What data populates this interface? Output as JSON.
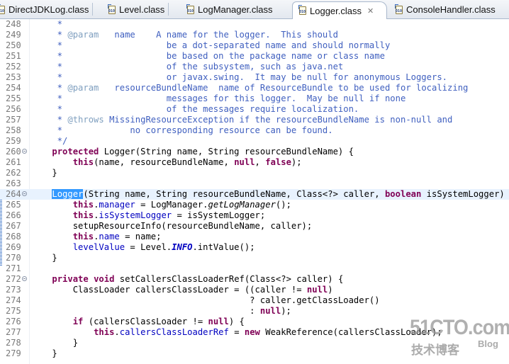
{
  "tabs": [
    {
      "label": "DirectJDKLog.class",
      "active": false
    },
    {
      "label": "Level.class",
      "active": false
    },
    {
      "label": "LogManager.class",
      "active": false
    },
    {
      "label": "Logger.class",
      "active": true,
      "close_icon": "close-icon"
    },
    {
      "label": "ConsoleHandler.class",
      "active": false
    }
  ],
  "editor": {
    "lines": [
      {
        "n": "248",
        "tokens": [
          [
            "cm",
            "     *"
          ]
        ]
      },
      {
        "n": "249",
        "tokens": [
          [
            "cm",
            "     * "
          ],
          [
            "tag",
            "@param"
          ],
          [
            "cm",
            "   name    A name for the logger.  This should"
          ]
        ]
      },
      {
        "n": "250",
        "tokens": [
          [
            "cm",
            "     *                    be a dot-separated name and should normally"
          ]
        ]
      },
      {
        "n": "251",
        "tokens": [
          [
            "cm",
            "     *                    be based on the package name or class name"
          ]
        ]
      },
      {
        "n": "252",
        "tokens": [
          [
            "cm",
            "     *                    of the subsystem, such as java.net"
          ]
        ]
      },
      {
        "n": "253",
        "tokens": [
          [
            "cm",
            "     *                    or javax.swing.  It may be null for anonymous Loggers."
          ]
        ]
      },
      {
        "n": "254",
        "tokens": [
          [
            "cm",
            "     * "
          ],
          [
            "tag",
            "@param"
          ],
          [
            "cm",
            "   resourceBundleName  name of ResourceBundle to be used for localizing"
          ]
        ]
      },
      {
        "n": "255",
        "tokens": [
          [
            "cm",
            "     *                    messages for this logger.  May be null if none"
          ]
        ]
      },
      {
        "n": "256",
        "tokens": [
          [
            "cm",
            "     *                    of the messages require localization."
          ]
        ]
      },
      {
        "n": "257",
        "tokens": [
          [
            "cm",
            "     * "
          ],
          [
            "tag",
            "@throws"
          ],
          [
            "cm",
            " MissingResourceException if the resourceBundleName is non-null and"
          ]
        ]
      },
      {
        "n": "258",
        "tokens": [
          [
            "cm",
            "     *             no corresponding resource can be found."
          ]
        ]
      },
      {
        "n": "259",
        "tokens": [
          [
            "cm",
            "     */"
          ]
        ]
      },
      {
        "n": "260",
        "fold": true,
        "tokens": [
          [
            "",
            "    "
          ],
          [
            "kw",
            "protected"
          ],
          [
            "",
            " Logger(String name, String resourceBundleName) {"
          ]
        ]
      },
      {
        "n": "261",
        "tokens": [
          [
            "",
            "        "
          ],
          [
            "kw",
            "this"
          ],
          [
            "",
            "(name, resourceBundleName, "
          ],
          [
            "kw",
            "null"
          ],
          [
            "",
            ", "
          ],
          [
            "kw",
            "false"
          ],
          [
            "",
            ");"
          ]
        ]
      },
      {
        "n": "262",
        "tokens": [
          [
            "",
            "    }"
          ]
        ]
      },
      {
        "n": "263",
        "tokens": []
      },
      {
        "n": "264",
        "fold": true,
        "current": true,
        "tokens": [
          [
            "",
            "    "
          ],
          [
            "sel",
            "Logger"
          ],
          [
            "",
            "(String name, String resourceBundleName, Class<?> caller, "
          ],
          [
            "kw",
            "boolean"
          ],
          [
            "",
            " isSystemLogger) {"
          ]
        ]
      },
      {
        "n": "265",
        "tokens": [
          [
            "",
            "        "
          ],
          [
            "kw",
            "this"
          ],
          [
            "",
            "."
          ],
          [
            "fld",
            "manager"
          ],
          [
            "",
            " = LogManager."
          ],
          [
            "it",
            "getLogManager"
          ],
          [
            "",
            "();"
          ]
        ]
      },
      {
        "n": "266",
        "tokens": [
          [
            "",
            "        "
          ],
          [
            "kw",
            "this"
          ],
          [
            "",
            "."
          ],
          [
            "fld",
            "isSystemLogger"
          ],
          [
            "",
            " = isSystemLogger;"
          ]
        ]
      },
      {
        "n": "267",
        "tokens": [
          [
            "",
            "        setupResourceInfo(resourceBundleName, caller);"
          ]
        ]
      },
      {
        "n": "268",
        "tokens": [
          [
            "",
            "        "
          ],
          [
            "kw",
            "this"
          ],
          [
            "",
            "."
          ],
          [
            "fld",
            "name"
          ],
          [
            "",
            " = name;"
          ]
        ]
      },
      {
        "n": "269",
        "tokens": [
          [
            "",
            "        "
          ],
          [
            "fld",
            "levelValue"
          ],
          [
            "",
            " = Level."
          ],
          [
            "fldit",
            "INFO"
          ],
          [
            "",
            ".intValue();"
          ]
        ]
      },
      {
        "n": "270",
        "tokens": [
          [
            "",
            "    }"
          ]
        ]
      },
      {
        "n": "271",
        "tokens": []
      },
      {
        "n": "272",
        "fold": true,
        "tokens": [
          [
            "",
            "    "
          ],
          [
            "kw",
            "private"
          ],
          [
            "",
            " "
          ],
          [
            "kw",
            "void"
          ],
          [
            "",
            " setCallersClassLoaderRef(Class<?> caller) {"
          ]
        ]
      },
      {
        "n": "273",
        "tokens": [
          [
            "",
            "        ClassLoader callersClassLoader = ((caller != "
          ],
          [
            "kw",
            "null"
          ],
          [
            "",
            ")"
          ]
        ]
      },
      {
        "n": "274",
        "tokens": [
          [
            "",
            "                                          ? caller.getClassLoader()"
          ]
        ]
      },
      {
        "n": "275",
        "tokens": [
          [
            "",
            "                                          : "
          ],
          [
            "kw",
            "null"
          ],
          [
            "",
            ");"
          ]
        ]
      },
      {
        "n": "276",
        "tokens": [
          [
            "",
            "        "
          ],
          [
            "kw",
            "if"
          ],
          [
            "",
            " (callersClassLoader != "
          ],
          [
            "kw",
            "null"
          ],
          [
            "",
            ") {"
          ]
        ]
      },
      {
        "n": "277",
        "tokens": [
          [
            "",
            "            "
          ],
          [
            "kw",
            "this"
          ],
          [
            "",
            "."
          ],
          [
            "fld",
            "callersClassLoaderRef"
          ],
          [
            "",
            " = "
          ],
          [
            "kw",
            "new"
          ],
          [
            "",
            " WeakReference(callersClassLoader);"
          ]
        ]
      },
      {
        "n": "278",
        "tokens": [
          [
            "",
            "        }"
          ]
        ]
      },
      {
        "n": "279",
        "tokens": [
          [
            "",
            "    }"
          ]
        ]
      }
    ]
  },
  "watermark": {
    "main": "51CTO.com",
    "sub": "技术博客",
    "blog": "Blog"
  }
}
